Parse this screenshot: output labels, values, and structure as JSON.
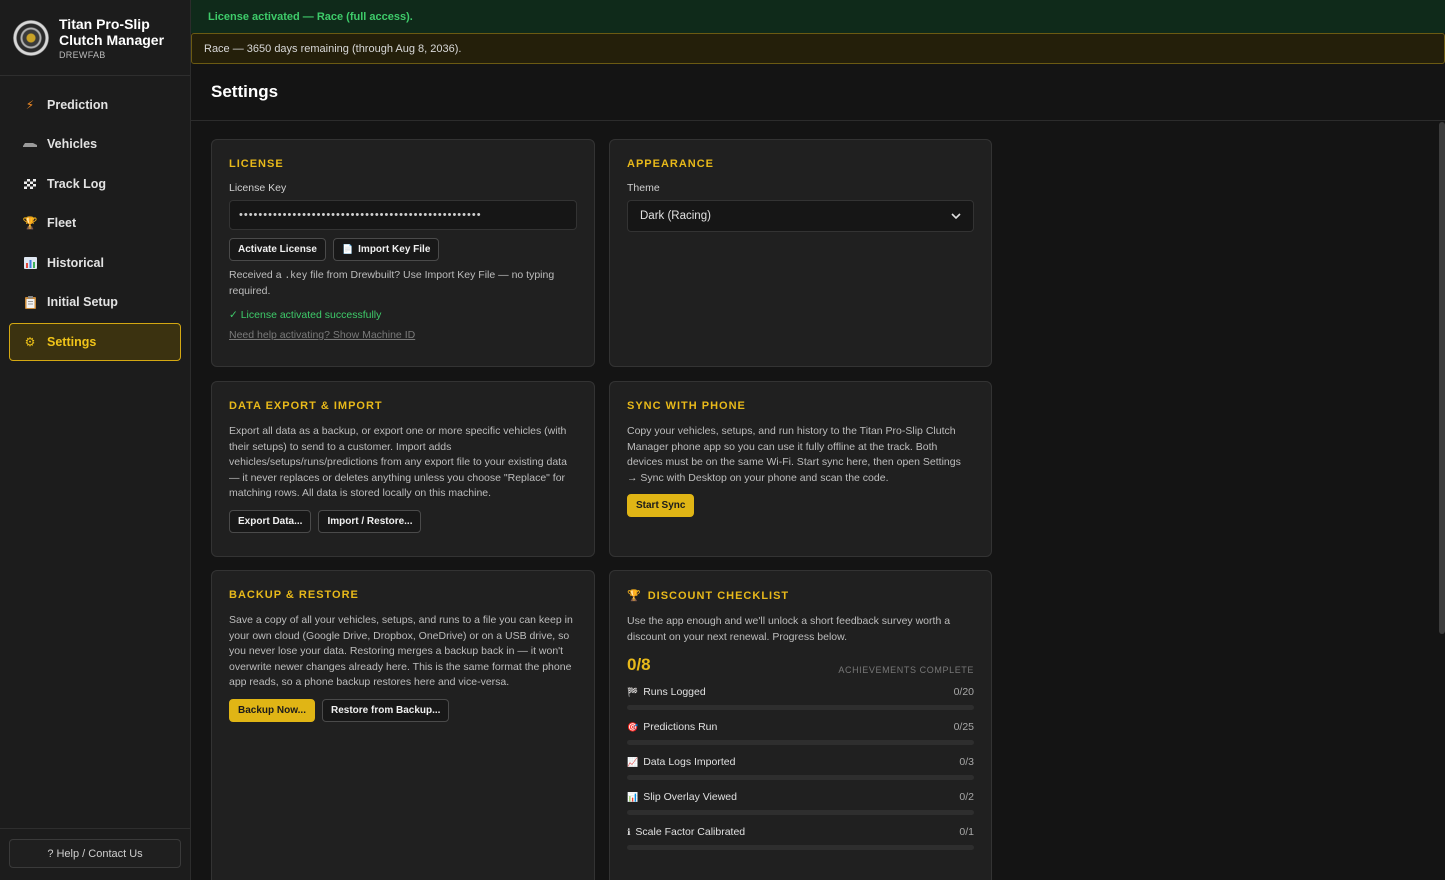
{
  "app": {
    "title": "Titan Pro-Slip Clutch Manager",
    "subtitle": "DREWFAB"
  },
  "sidebar": {
    "items": [
      {
        "label": "Prediction",
        "icon": "lightning-icon"
      },
      {
        "label": "Vehicles",
        "icon": "car-icon"
      },
      {
        "label": "Track Log",
        "icon": "checkered-flag-icon"
      },
      {
        "label": "Fleet",
        "icon": "trophy-icon"
      },
      {
        "label": "Historical",
        "icon": "bar-chart-icon"
      },
      {
        "label": "Initial Setup",
        "icon": "clipboard-icon"
      },
      {
        "label": "Settings",
        "icon": "gear-icon",
        "active": true
      }
    ],
    "help_label": "? Help / Contact Us"
  },
  "banners": {
    "success": "License activated — Race (full access).",
    "warning": "Race — 3650 days remaining (through Aug 8, 2036)."
  },
  "page": {
    "title": "Settings"
  },
  "license": {
    "title": "LICENSE",
    "key_label": "License Key",
    "key_value": "••••••••••••••••••••••••••••••••••••••••••••••••••",
    "activate_label": "Activate License",
    "import_label": "Import Key File",
    "desc_pre": "Received a ",
    "desc_mono": ".key",
    "desc_post": " file from Drewbuilt? Use Import Key File — no typing required.",
    "status": "✓ License activated successfully",
    "help_link": "Need help activating? Show Machine ID"
  },
  "appearance": {
    "title": "APPEARANCE",
    "theme_label": "Theme",
    "theme_value": "Dark (Racing)"
  },
  "data_export": {
    "title": "DATA EXPORT & IMPORT",
    "desc": "Export all data as a backup, or export one or more specific vehicles (with their setups) to send to a customer. Import adds vehicles/setups/runs/predictions from any export file to your existing data — it never replaces or deletes anything unless you choose \"Replace\" for matching rows. All data is stored locally on this machine.",
    "export_label": "Export Data...",
    "import_label": "Import / Restore..."
  },
  "sync": {
    "title": "SYNC WITH PHONE",
    "desc": "Copy your vehicles, setups, and run history to the Titan Pro-Slip Clutch Manager phone app so you can use it fully offline at the track. Both devices must be on the same Wi-Fi. Start sync here, then open Settings → Sync with Desktop on your phone and scan the code.",
    "start_label": "Start Sync"
  },
  "backup": {
    "title": "BACKUP & RESTORE",
    "desc": "Save a copy of all your vehicles, setups, and runs to a file you can keep in your own cloud (Google Drive, Dropbox, OneDrive) or on a USB drive, so you never lose your data. Restoring merges a backup back in — it won't overwrite newer changes already here. This is the same format the phone app reads, so a phone backup restores here and vice-versa.",
    "backup_label": "Backup Now...",
    "restore_label": "Restore from Backup..."
  },
  "discount": {
    "title": "DISCOUNT CHECKLIST",
    "desc": "Use the app enough and we'll unlock a short feedback survey worth a discount on your next renewal. Progress below.",
    "score": "0/8",
    "score_caption": "ACHIEVEMENTS COMPLETE",
    "achievements": [
      {
        "label": "Runs Logged",
        "icon": "checkered-flag-icon",
        "count": "0/20",
        "progress": 0
      },
      {
        "label": "Predictions Run",
        "icon": "target-icon",
        "count": "0/25",
        "progress": 0
      },
      {
        "label": "Data Logs Imported",
        "icon": "line-chart-icon",
        "count": "0/3",
        "progress": 0
      },
      {
        "label": "Slip Overlay Viewed",
        "icon": "bar-chart-icon",
        "count": "0/2",
        "progress": 0
      },
      {
        "label": "Scale Factor Calibrated",
        "icon": "info-icon",
        "count": "0/1",
        "progress": 0
      }
    ]
  }
}
